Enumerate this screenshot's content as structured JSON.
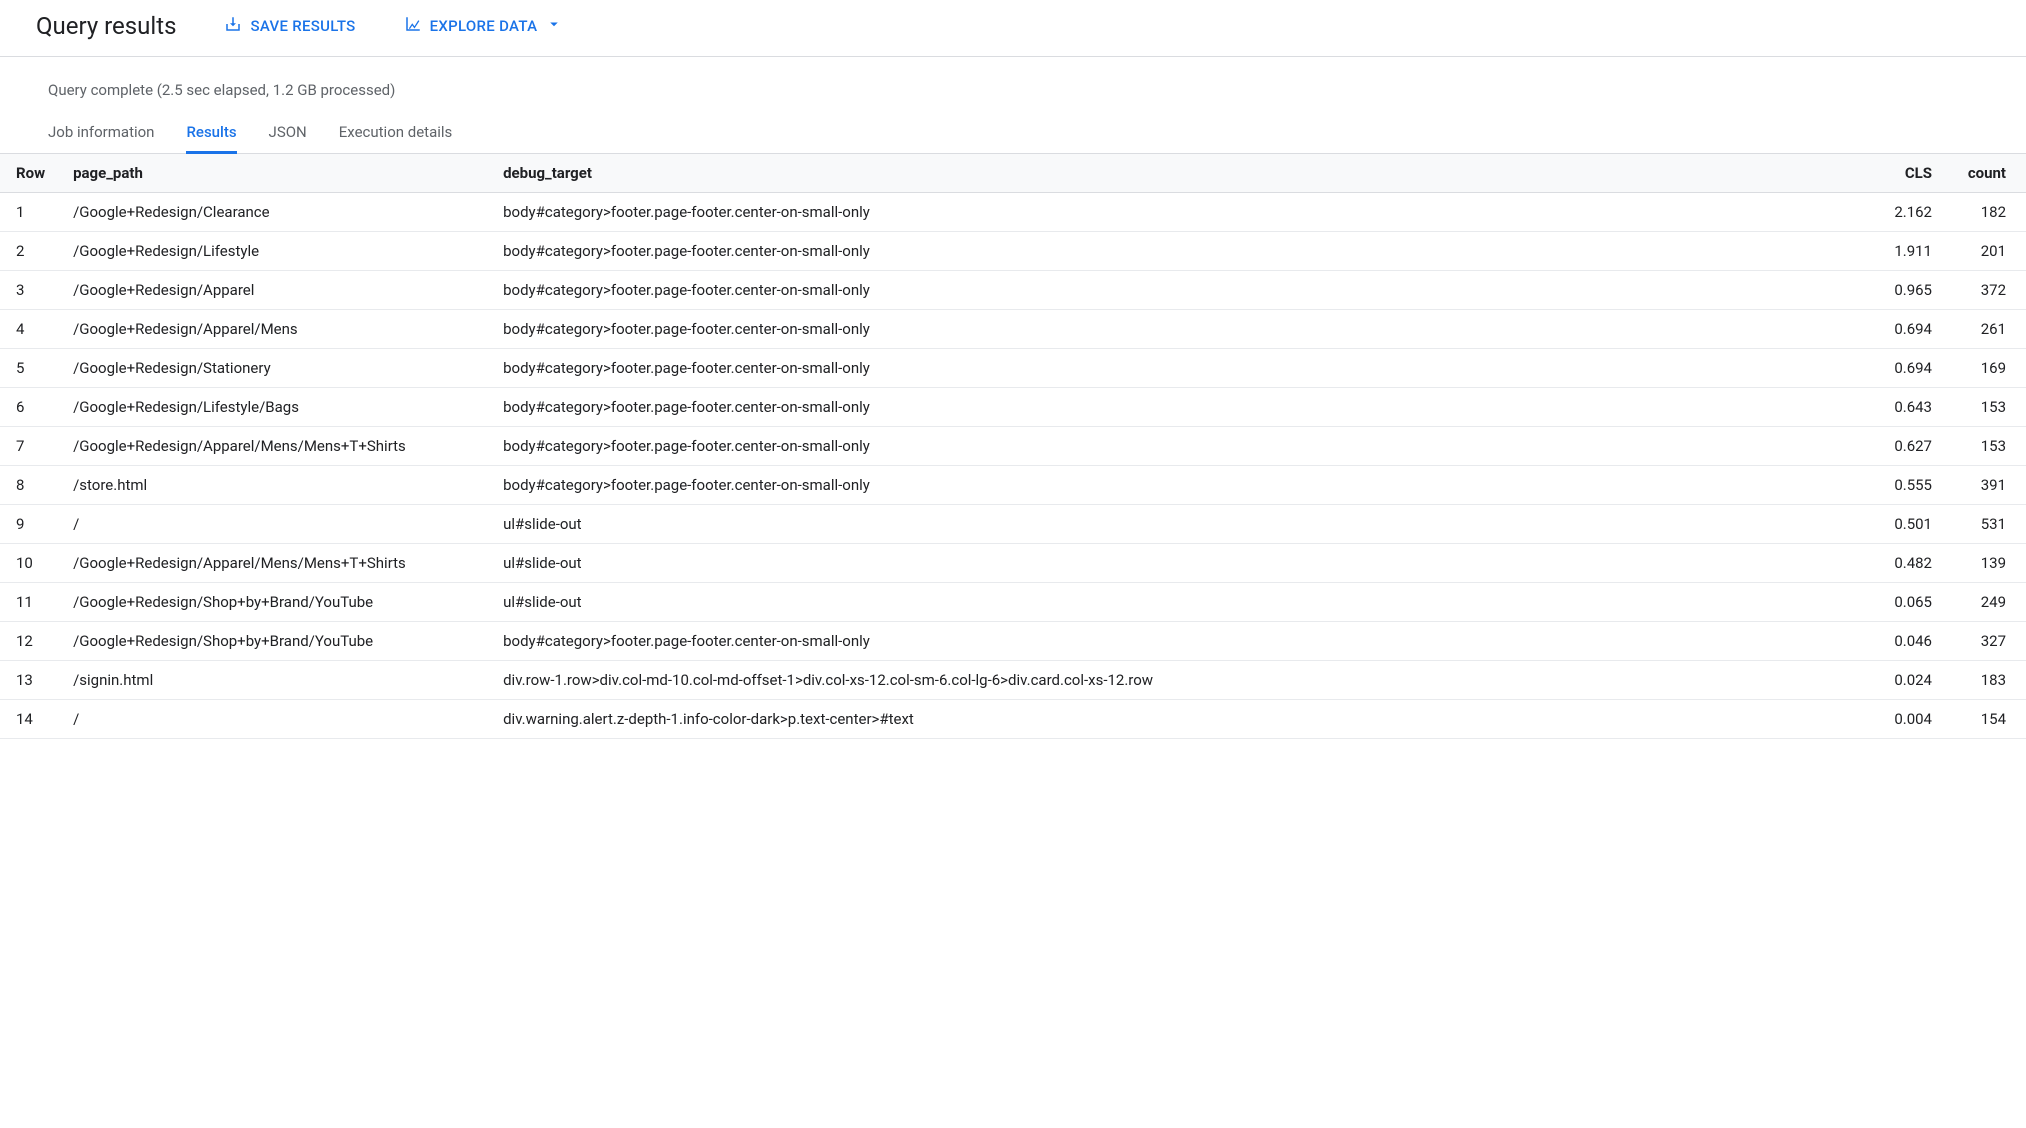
{
  "header": {
    "title": "Query results",
    "save_label": "Save Results",
    "explore_label": "Explore Data"
  },
  "status": "Query complete (2.5 sec elapsed, 1.2 GB processed)",
  "tabs": {
    "job": "Job information",
    "results": "Results",
    "json": "JSON",
    "execution": "Execution details"
  },
  "columns": {
    "row": "Row",
    "page_path": "page_path",
    "debug_target": "debug_target",
    "cls": "CLS",
    "count": "count"
  },
  "rows": [
    {
      "n": "1",
      "page_path": "/Google+Redesign/Clearance",
      "debug_target": "body#category>footer.page-footer.center-on-small-only",
      "cls": "2.162",
      "count": "182"
    },
    {
      "n": "2",
      "page_path": "/Google+Redesign/Lifestyle",
      "debug_target": "body#category>footer.page-footer.center-on-small-only",
      "cls": "1.911",
      "count": "201"
    },
    {
      "n": "3",
      "page_path": "/Google+Redesign/Apparel",
      "debug_target": "body#category>footer.page-footer.center-on-small-only",
      "cls": "0.965",
      "count": "372"
    },
    {
      "n": "4",
      "page_path": "/Google+Redesign/Apparel/Mens",
      "debug_target": "body#category>footer.page-footer.center-on-small-only",
      "cls": "0.694",
      "count": "261"
    },
    {
      "n": "5",
      "page_path": "/Google+Redesign/Stationery",
      "debug_target": "body#category>footer.page-footer.center-on-small-only",
      "cls": "0.694",
      "count": "169"
    },
    {
      "n": "6",
      "page_path": "/Google+Redesign/Lifestyle/Bags",
      "debug_target": "body#category>footer.page-footer.center-on-small-only",
      "cls": "0.643",
      "count": "153"
    },
    {
      "n": "7",
      "page_path": "/Google+Redesign/Apparel/Mens/Mens+T+Shirts",
      "debug_target": "body#category>footer.page-footer.center-on-small-only",
      "cls": "0.627",
      "count": "153"
    },
    {
      "n": "8",
      "page_path": "/store.html",
      "debug_target": "body#category>footer.page-footer.center-on-small-only",
      "cls": "0.555",
      "count": "391"
    },
    {
      "n": "9",
      "page_path": "/",
      "debug_target": "ul#slide-out",
      "cls": "0.501",
      "count": "531"
    },
    {
      "n": "10",
      "page_path": "/Google+Redesign/Apparel/Mens/Mens+T+Shirts",
      "debug_target": "ul#slide-out",
      "cls": "0.482",
      "count": "139"
    },
    {
      "n": "11",
      "page_path": "/Google+Redesign/Shop+by+Brand/YouTube",
      "debug_target": "ul#slide-out",
      "cls": "0.065",
      "count": "249"
    },
    {
      "n": "12",
      "page_path": "/Google+Redesign/Shop+by+Brand/YouTube",
      "debug_target": "body#category>footer.page-footer.center-on-small-only",
      "cls": "0.046",
      "count": "327"
    },
    {
      "n": "13",
      "page_path": "/signin.html",
      "debug_target": "div.row-1.row>div.col-md-10.col-md-offset-1>div.col-xs-12.col-sm-6.col-lg-6>div.card.col-xs-12.row",
      "cls": "0.024",
      "count": "183"
    },
    {
      "n": "14",
      "page_path": "/",
      "debug_target": "div.warning.alert.z-depth-1.info-color-dark>p.text-center>#text",
      "cls": "0.004",
      "count": "154"
    }
  ]
}
